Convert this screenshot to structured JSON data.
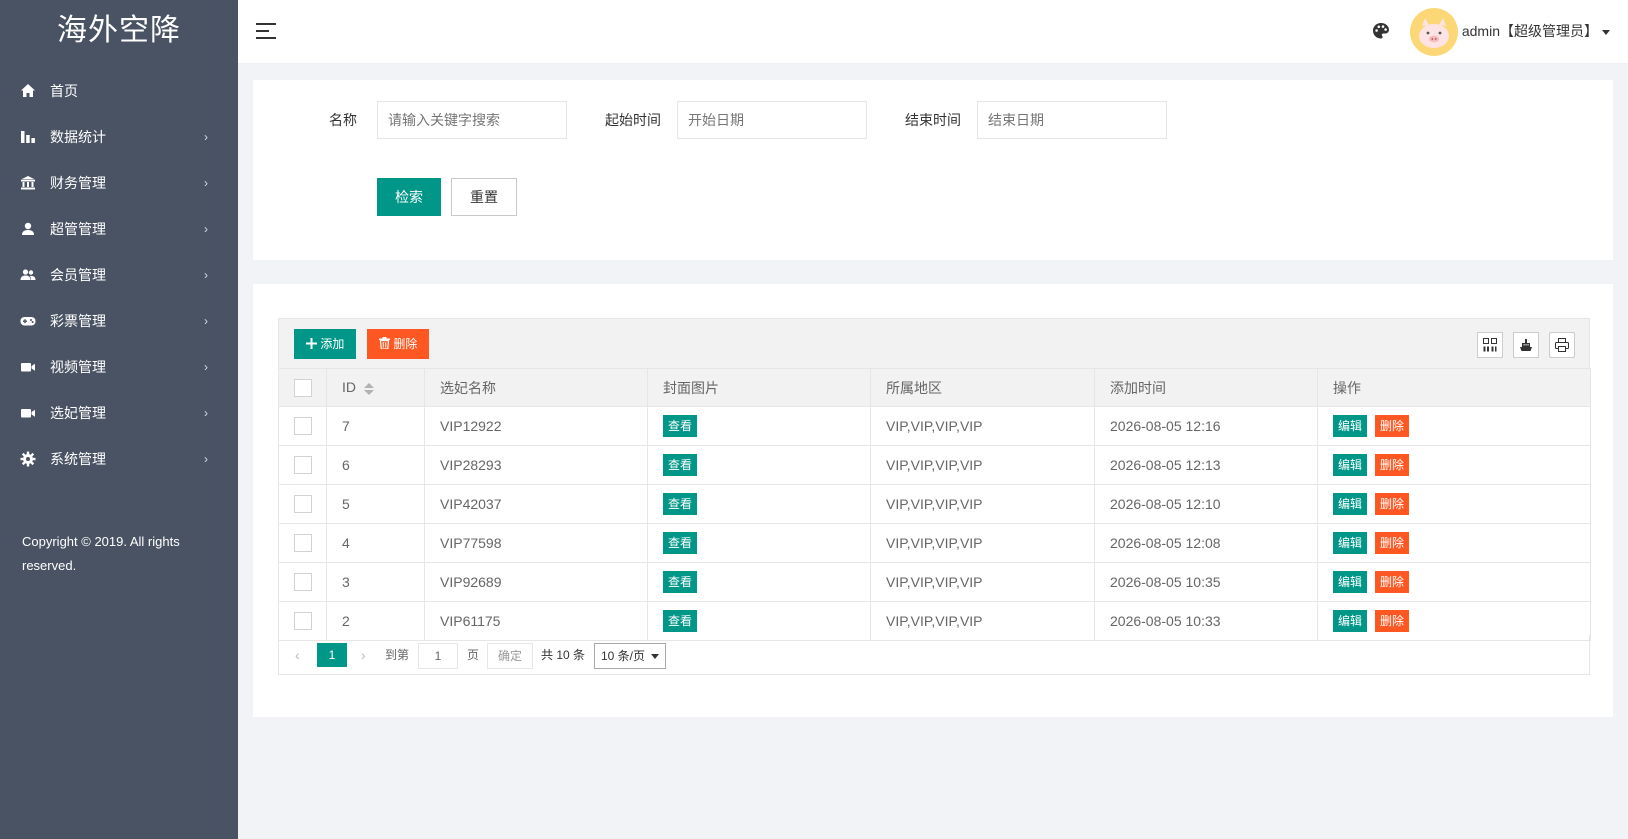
{
  "app": {
    "title": "海外空降"
  },
  "sidebar": {
    "items": [
      {
        "label": "首页",
        "icon": "home-icon",
        "has_children": false
      },
      {
        "label": "数据统计",
        "icon": "bar-chart-icon",
        "has_children": true
      },
      {
        "label": "财务管理",
        "icon": "bank-icon",
        "has_children": true
      },
      {
        "label": "超管管理",
        "icon": "user-icon",
        "has_children": true
      },
      {
        "label": "会员管理",
        "icon": "users-icon",
        "has_children": true
      },
      {
        "label": "彩票管理",
        "icon": "gamepad-icon",
        "has_children": true
      },
      {
        "label": "视频管理",
        "icon": "video-camera-icon",
        "has_children": true
      },
      {
        "label": "选妃管理",
        "icon": "video-camera-icon",
        "has_children": true
      },
      {
        "label": "系统管理",
        "icon": "gear-icon",
        "has_children": true
      }
    ],
    "arrow": "›",
    "copyright": "Copyright © 2019. All rights reserved."
  },
  "header": {
    "menu_icon": "hamburger-icon",
    "theme_icon": "palette-icon",
    "user_label": "admin【超级管理员】"
  },
  "search": {
    "name_label": "名称",
    "name_placeholder": "请输入关键字搜索",
    "start_label": "起始时间",
    "start_placeholder": "开始日期",
    "end_label": "结束时间",
    "end_placeholder": "结束日期",
    "search_button": "检索",
    "reset_button": "重置"
  },
  "toolbar": {
    "add_label": "添加",
    "delete_label": "删除",
    "icons": [
      "columns-icon",
      "export-icon",
      "print-icon"
    ]
  },
  "table": {
    "columns": [
      "ID",
      "选妃名称",
      "封面图片",
      "所属地区",
      "添加时间",
      "操作"
    ],
    "rows": [
      {
        "id": "7",
        "name": "VIP12922",
        "cover": "查看",
        "region": "VIP,VIP,VIP,VIP",
        "time": "2026-08-05 12:16",
        "edit": "编辑",
        "del": "删除"
      },
      {
        "id": "6",
        "name": "VIP28293",
        "cover": "查看",
        "region": "VIP,VIP,VIP,VIP",
        "time": "2026-08-05 12:13",
        "edit": "编辑",
        "del": "删除"
      },
      {
        "id": "5",
        "name": "VIP42037",
        "cover": "查看",
        "region": "VIP,VIP,VIP,VIP",
        "time": "2026-08-05 12:10",
        "edit": "编辑",
        "del": "删除"
      },
      {
        "id": "4",
        "name": "VIP77598",
        "cover": "查看",
        "region": "VIP,VIP,VIP,VIP",
        "time": "2026-08-05 12:08",
        "edit": "编辑",
        "del": "删除"
      },
      {
        "id": "3",
        "name": "VIP92689",
        "cover": "查看",
        "region": "VIP,VIP,VIP,VIP",
        "time": "2026-08-05 10:35",
        "edit": "编辑",
        "del": "删除"
      },
      {
        "id": "2",
        "name": "VIP61175",
        "cover": "查看",
        "region": "VIP,VIP,VIP,VIP",
        "time": "2026-08-05 10:33",
        "edit": "编辑",
        "del": "删除"
      }
    ]
  },
  "pager": {
    "prev": "‹",
    "current": "1",
    "next": "›",
    "goto_label": "到第",
    "goto_value": "1",
    "page_unit": "页",
    "confirm": "确定",
    "total": "共 10 条",
    "page_size": "10 条/页"
  },
  "colors": {
    "sidebar": "#4a5363",
    "primary": "#009688",
    "danger": "#ff5722",
    "background": "#f2f3f7"
  }
}
